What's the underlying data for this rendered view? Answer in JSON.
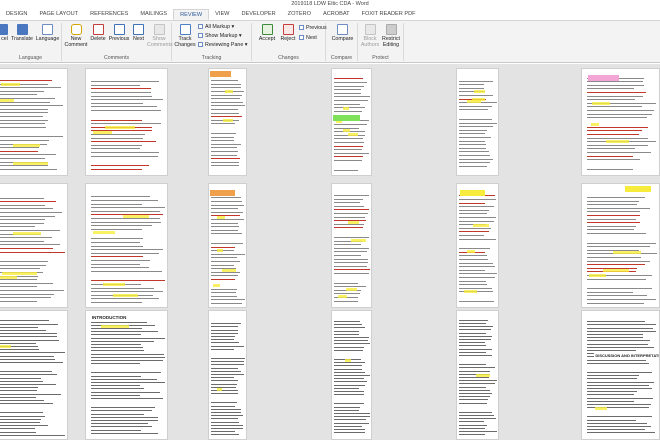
{
  "window": {
    "title": "2019118 LDW Eltic CDA - Word"
  },
  "tabs": [
    "DESIGN",
    "PAGE LAYOUT",
    "REFERENCES",
    "MAILINGS",
    "REVIEW",
    "VIEW",
    "DEVELOPER",
    "ZOTERO",
    "ACROBAT",
    "FOXIT READER PDF"
  ],
  "active_tab": "REVIEW",
  "ribbon": {
    "language": {
      "label": "Language",
      "buttons": [
        "Translate",
        "Language"
      ],
      "partial": "cel"
    },
    "comments": {
      "label": "Comments",
      "new": "New Comment",
      "new_l1": "New",
      "new_l2": "Comment",
      "delete": "Delete",
      "previous": "Previous",
      "next": "Next",
      "show_l1": "Show",
      "show_l2": "Comments"
    },
    "tracking": {
      "label": "Tracking",
      "track_l1": "Track",
      "track_l2": "Changes",
      "all_markup": "All Markup",
      "show_markup": "Show Markup",
      "reviewing_pane": "Reviewing Pane"
    },
    "changes": {
      "label": "Changes",
      "accept": "Accept",
      "reject": "Reject",
      "previous": "Previous",
      "next": "Next"
    },
    "compare": {
      "label": "Compare",
      "compare": "Compare"
    },
    "protect": {
      "label": "Protect",
      "block_l1": "Block",
      "block_l2": "Authors",
      "restrict_l1": "Restrict",
      "restrict_l2": "Editing"
    }
  },
  "colors": {
    "accent": "#2b579a",
    "highlight_yellow": "#f7ec3c",
    "highlight_green": "#7fe05a",
    "highlight_orange": "#f0a04a",
    "highlight_pink": "#f3a6d6",
    "markup_red": "#c0392b"
  },
  "pages_view": {
    "rows": 3,
    "pages_per_row": 6,
    "page_headings": {
      "row3_col2": "INTRODUCTION",
      "row3_col6": "DISCUSSION AND INTERPRETATION"
    }
  }
}
